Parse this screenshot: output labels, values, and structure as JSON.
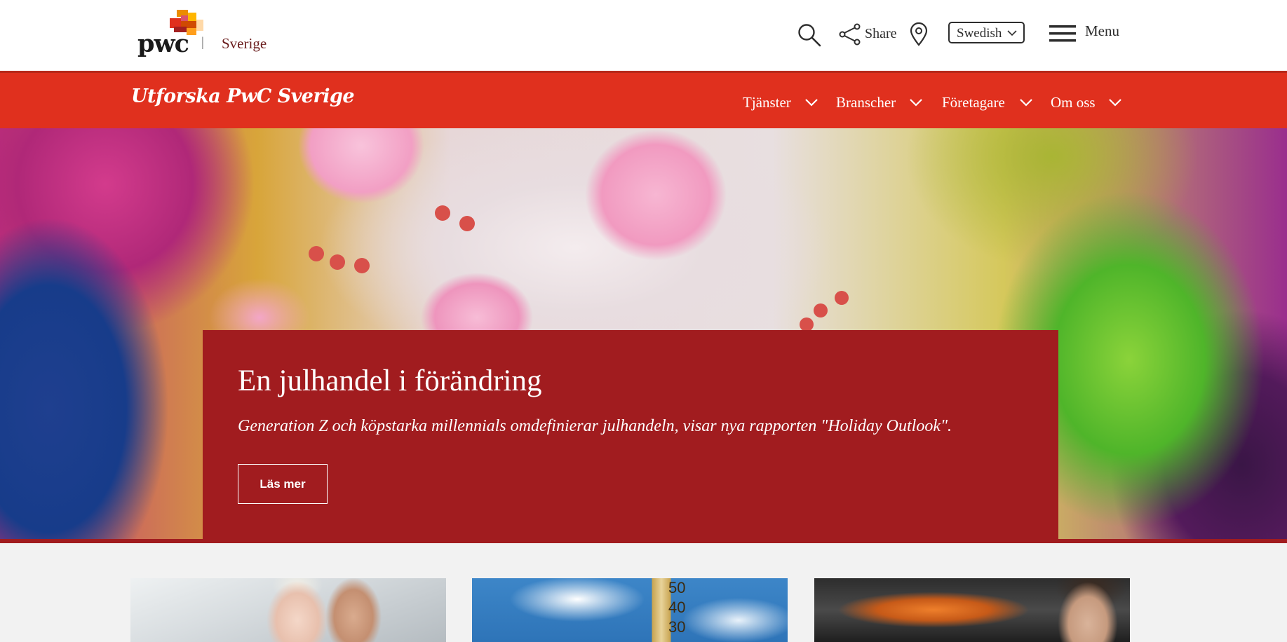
{
  "header": {
    "logo_text": "pwc",
    "separator": "|",
    "region": "Sverige",
    "share_label": "Share",
    "language": "Swedish",
    "menu_label": "Menu"
  },
  "nav": {
    "brand": "Utforska PwC Sverige",
    "items": [
      {
        "label": "Tjänster"
      },
      {
        "label": "Branscher"
      },
      {
        "label": "Företagare"
      },
      {
        "label": "Om oss"
      }
    ]
  },
  "hero": {
    "headline": "En julhandel i förändring",
    "subhead": "Generation Z och köpstarka millennials omdefinierar julhandeln, visar nya rapporten \"Holiday Outlook\".",
    "cta_label": "Läs mer"
  },
  "cards": {
    "thermometer_marks": [
      "50",
      "40",
      "30"
    ]
  },
  "colors": {
    "brand_red": "#e0301e",
    "hero_card": "#a11c1f",
    "logo_orange": "#eb8c00"
  },
  "icons": [
    "search-icon",
    "share-icon",
    "location-pin-icon",
    "chevron-down-icon",
    "hamburger-menu-icon"
  ]
}
